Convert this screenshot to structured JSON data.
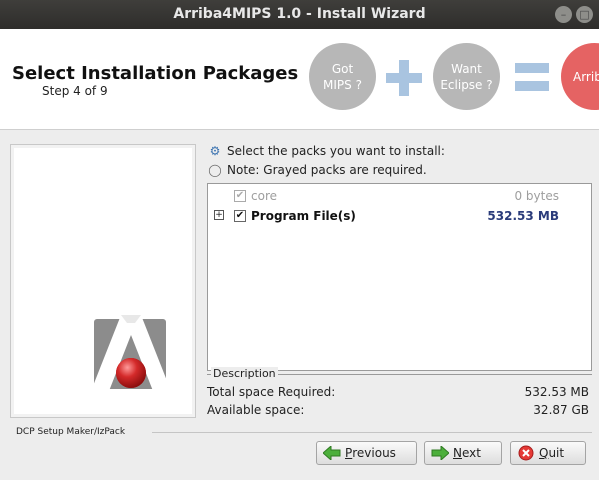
{
  "window": {
    "title": "Arriba4MIPS 1.0 - Install Wizard"
  },
  "header": {
    "title": "Select Installation Packages",
    "step": "Step 4 of 9",
    "bubbles": [
      {
        "line1": "Got",
        "line2": "MIPS ?"
      },
      {
        "line1": "Want",
        "line2": "Eclipse ?"
      },
      {
        "line1": "Arrib",
        "line2": ""
      }
    ]
  },
  "packs": {
    "instruction": "Select the packs you want to install:",
    "note": "Note: Grayed packs are required.",
    "items": [
      {
        "name": "core",
        "size": "0 bytes",
        "checked": true,
        "required": true
      },
      {
        "name": "Program File(s)",
        "size": "532.53 MB",
        "checked": true,
        "required": false
      }
    ],
    "description_label": "Description"
  },
  "space": {
    "required_label": "Total space Required:",
    "required_value": "532.53 MB",
    "available_label": "Available space:",
    "available_value": "32.87 GB"
  },
  "footer": {
    "brand": "DCP Setup Maker/IzPack"
  },
  "buttons": {
    "previous": {
      "mnemonic": "P",
      "rest": "revious"
    },
    "next": {
      "mnemonic": "N",
      "rest": "ext"
    },
    "quit": {
      "mnemonic": "Q",
      "rest": "uit"
    }
  },
  "colors": {
    "bubble_gray": "#b7b7b7",
    "bubble_red": "#e56363",
    "operator_blue": "#a9c4e0",
    "size_blue": "#2a3b7a"
  }
}
